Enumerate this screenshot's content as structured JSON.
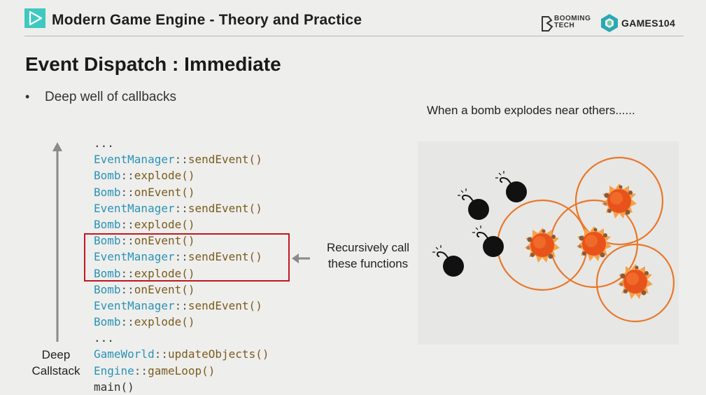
{
  "header": {
    "course_title": "Modern Game Engine - Theory and Practice",
    "logo_booming_top": "BOOMING",
    "logo_booming_bottom": "TECH",
    "logo_games": "GAMES104"
  },
  "slide": {
    "title": "Event Dispatch : Immediate",
    "bullet": "Deep well of callbacks",
    "caption": "When a bomb explodes near others......",
    "recursive_label_1": "Recursively call",
    "recursive_label_2": "these functions",
    "deep_label_1": "Deep",
    "deep_label_2": "Callstack"
  },
  "code_lines": [
    {
      "cls": "",
      "fn": "..."
    },
    {
      "cls": "EventManager",
      "fn": "sendEvent()"
    },
    {
      "cls": "Bomb",
      "fn": "explode()"
    },
    {
      "cls": "Bomb",
      "fn": "onEvent()"
    },
    {
      "cls": "EventManager",
      "fn": "sendEvent()"
    },
    {
      "cls": "Bomb",
      "fn": "explode()"
    },
    {
      "cls": "Bomb",
      "fn": "onEvent()"
    },
    {
      "cls": "EventManager",
      "fn": "sendEvent()"
    },
    {
      "cls": "Bomb",
      "fn": "explode()"
    },
    {
      "cls": "Bomb",
      "fn": "onEvent()"
    },
    {
      "cls": "EventManager",
      "fn": "sendEvent()"
    },
    {
      "cls": "Bomb",
      "fn": "explode()"
    },
    {
      "cls": "",
      "fn": "..."
    },
    {
      "cls": "GameWorld",
      "fn": "updateObjects()"
    },
    {
      "cls": "Engine",
      "fn": "gameLoop()"
    },
    {
      "cls": "",
      "fn": "main()"
    }
  ],
  "colors": {
    "accent_teal": "#3ec9c0",
    "highlight_red": "#c01822",
    "class_blue": "#2a93b6",
    "method_brown": "#7a5c1e",
    "ring_orange": "#e8782a",
    "explosion_red": "#e8531b"
  },
  "icons": {
    "header_logo": "play-triangle-icon",
    "booming_logo": "booming-tech-logo",
    "games_logo": "games104-logo",
    "bomb": "bomb-icon",
    "explosion": "explosion-icon"
  }
}
